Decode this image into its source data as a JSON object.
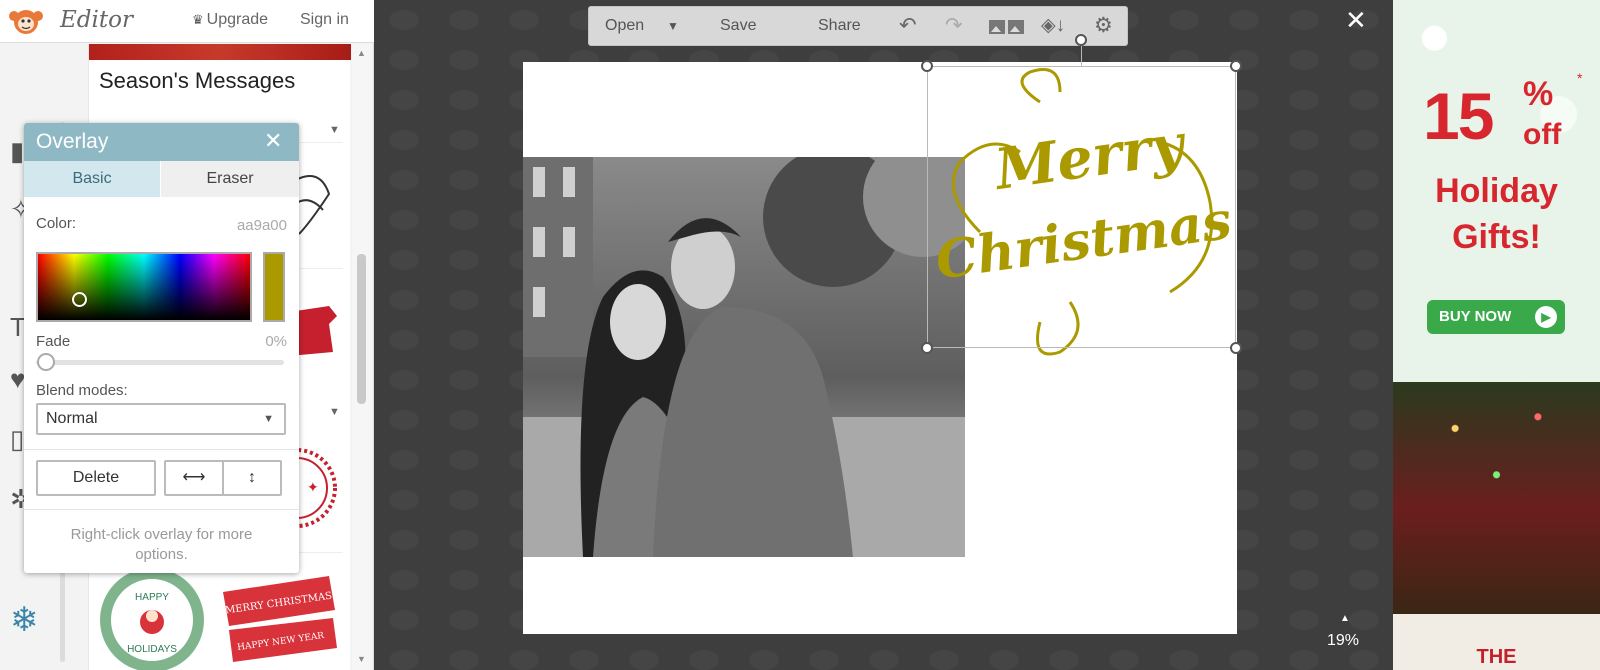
{
  "app": {
    "name": "Editor",
    "upgrade_label": "Upgrade",
    "signin_label": "Sign in"
  },
  "panel": {
    "title": "Season's Messages"
  },
  "overlay": {
    "title": "Overlay",
    "tabs": [
      "Basic",
      "Eraser"
    ],
    "active_tab": "Basic",
    "color_label": "Color:",
    "color_value": "aa9a00",
    "color_hex": "#aa9a00",
    "fade_label": "Fade",
    "fade_value": "0%",
    "blend_label": "Blend modes:",
    "blend_value": "Normal",
    "delete_label": "Delete",
    "hint": "Right-click overlay for more options."
  },
  "toolbar": {
    "open_label": "Open",
    "save_label": "Save",
    "share_label": "Share"
  },
  "canvas": {
    "overlay_text_line1": "Merry",
    "overlay_text_line2": "Christmas",
    "zoom": "19%"
  },
  "thumbnails": {
    "sticker_1": "MERRY CHRISTMAS",
    "sticker_2": "HAPPY NEW YEAR",
    "badge_top": "HAPPY",
    "badge_bottom": "HOLIDAYS"
  },
  "ad": {
    "percent": "15",
    "pct_sign": "%",
    "off": "off",
    "star": "*",
    "line1": "Holiday",
    "line2": "Gifts!",
    "buy_label": "BUY NOW",
    "brand": "THE"
  }
}
